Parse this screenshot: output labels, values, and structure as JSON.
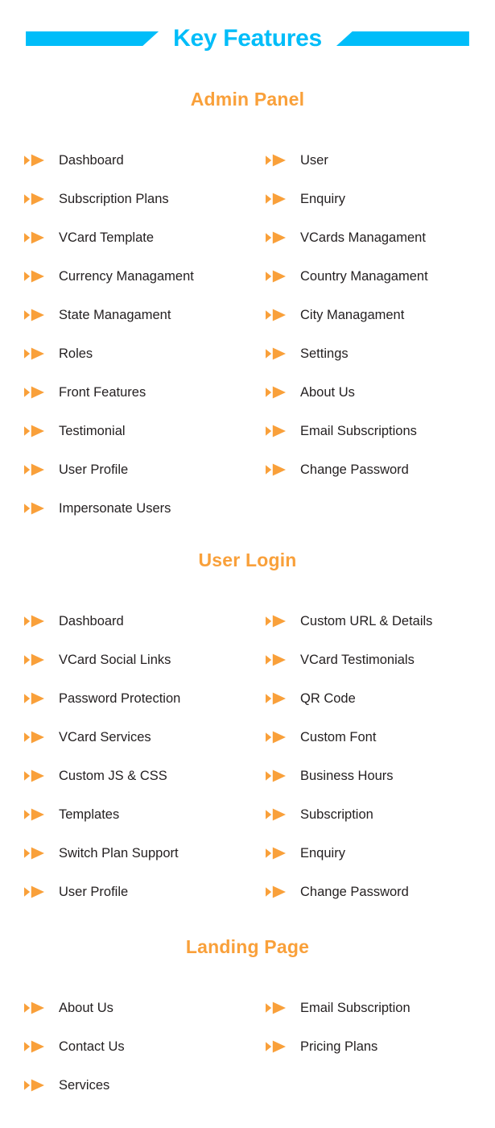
{
  "header": {
    "title": "Key Features",
    "accent_color": "#00bdf9",
    "left_bar_name": "left-accent-bar",
    "right_bar_name": "right-accent-bar"
  },
  "theme": {
    "heading_color": "#f9a03a",
    "bullet_color": "#f9a03a",
    "text_color": "#231f20",
    "background": "#ffffff"
  },
  "sections": [
    {
      "title": "Admin Panel",
      "left_items": [
        "Dashboard",
        "Subscription Plans",
        "VCard Template",
        "Currency Managament",
        "State Managament",
        "Roles",
        "Front Features",
        "Testimonial",
        "User Profile",
        "Impersonate Users"
      ],
      "right_items": [
        "User",
        "Enquiry",
        "VCards Managament",
        "Country Managament",
        "City Managament",
        "Settings",
        "About Us",
        "Email Subscriptions",
        "Change Password"
      ]
    },
    {
      "title": "User Login",
      "left_items": [
        "Dashboard",
        "VCard Social Links",
        "Password Protection",
        "VCard Services",
        "Custom JS & CSS",
        "Templates",
        "Switch Plan Support",
        "User Profile"
      ],
      "right_items": [
        "Custom URL & Details",
        "VCard Testimonials",
        "QR Code",
        "Custom Font",
        "Business Hours",
        "Subscription",
        "Enquiry",
        "Change Password"
      ]
    },
    {
      "title": "Landing  Page",
      "left_items": [
        "About Us",
        "Contact Us",
        "Services"
      ],
      "right_items": [
        "Email Subscription",
        "Pricing Plans"
      ]
    }
  ]
}
